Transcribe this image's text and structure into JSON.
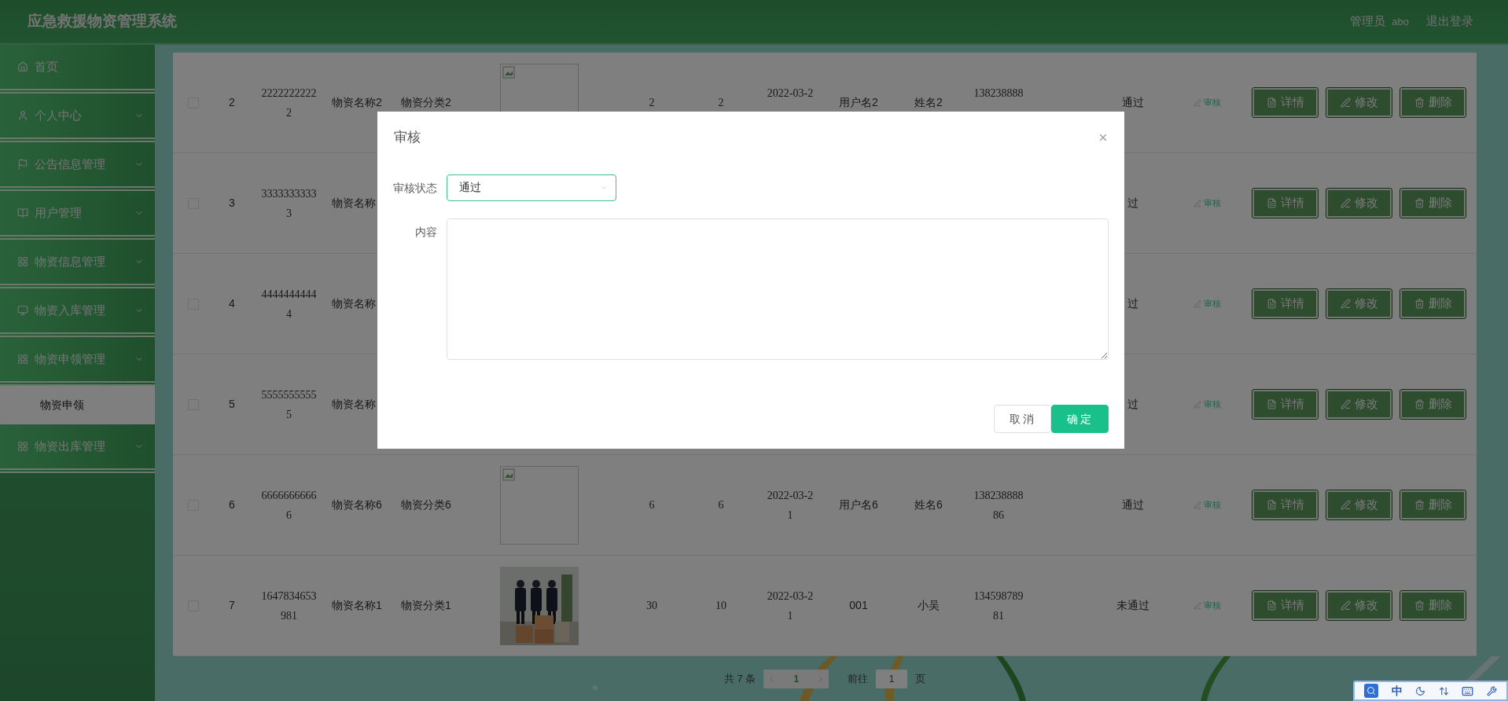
{
  "header": {
    "title": "应急救援物资管理系统",
    "role": "管理员",
    "username": "abo",
    "logout": "退出登录"
  },
  "sidebar": {
    "items": [
      {
        "label": "首页",
        "kind": "link"
      },
      {
        "label": "个人中心",
        "kind": "menu"
      },
      {
        "label": "公告信息管理",
        "kind": "menu"
      },
      {
        "label": "用户管理",
        "kind": "menu"
      },
      {
        "label": "物资信息管理",
        "kind": "menu"
      },
      {
        "label": "物资入库管理",
        "kind": "menu"
      },
      {
        "label": "物资申领管理",
        "kind": "menu",
        "children": [
          {
            "label": "物资申领",
            "selected": true
          }
        ]
      },
      {
        "label": "物资出库管理",
        "kind": "menu"
      }
    ]
  },
  "table": {
    "rows": [
      {
        "checked": false,
        "column_2": "2",
        "column_3": "22222222222",
        "column_4": "物资名称2",
        "column_5": "物资分类2",
        "column_6": {
          "kind": "broken_image"
        },
        "column_7": "2",
        "column_8": "2",
        "column_9": "2022-03-2",
        "column_10": "用户名2",
        "column_11": "姓名2",
        "column_12": "138238888",
        "column_13": "通过",
        "review_link": "审核",
        "actions": [
          "详情",
          "修改",
          "删除"
        ]
      },
      {
        "checked": false,
        "column_2": "3",
        "column_3": "33333333333",
        "column_4": "物资名称",
        "column_13": "过",
        "review_link": "审核",
        "actions": [
          "详情",
          "修改",
          "删除"
        ]
      },
      {
        "checked": false,
        "column_2": "4",
        "column_3": "44444444444",
        "column_4": "物资名称",
        "column_13": "过",
        "review_link": "审核",
        "actions": [
          "详情",
          "修改",
          "删除"
        ]
      },
      {
        "checked": false,
        "column_2": "5",
        "column_3": "55555555555",
        "column_4": "物资名称",
        "column_13": "过",
        "review_link": "审核",
        "actions": [
          "详情",
          "修改",
          "删除"
        ]
      },
      {
        "checked": false,
        "column_2": "6",
        "column_3": "66666666666",
        "column_4": "物资名称6",
        "column_5": "物资分类6",
        "column_6": {
          "kind": "broken_image"
        },
        "column_7": "6",
        "column_8": "6",
        "column_9": "2022-03-21",
        "column_10": "用户名6",
        "column_11": "姓名6",
        "column_12": "13823888886",
        "column_13": "通过",
        "review_link": "审核",
        "actions": [
          "详情",
          "修改",
          "删除"
        ]
      },
      {
        "checked": false,
        "column_2": "7",
        "column_3": "1647834653981",
        "column_4": "物资名称1",
        "column_5": "物资分类1",
        "column_7": "30",
        "column_8": "10",
        "column_9": "2022-03-21",
        "column_10": "001",
        "column_11": "小吴",
        "column_12": "13459878981",
        "column_13": "未通过",
        "review_link": "审核",
        "actions": [
          "详情",
          "修改",
          "删除"
        ]
      }
    ]
  },
  "pagination": {
    "total": "共 7 条",
    "pages": [
      {
        "label": "1",
        "selected": true
      }
    ],
    "goto_label": "前往",
    "goto_value": "1",
    "page_suffix": "页"
  },
  "dialog": {
    "title": "审核",
    "fields": [
      {
        "kind": "select",
        "label": "审核状态",
        "value": "通过"
      },
      {
        "kind": "textarea",
        "label": "内容"
      }
    ],
    "buttons": [
      {
        "kind": "secondary",
        "label": "取消"
      },
      {
        "kind": "primary",
        "label": "确定"
      }
    ]
  },
  "ime_bar": {
    "mode": "中"
  }
}
